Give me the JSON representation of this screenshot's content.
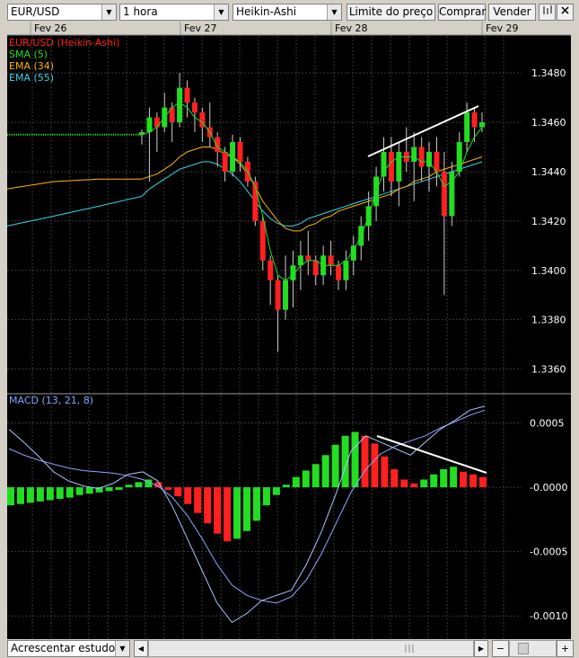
{
  "toolbar": {
    "symbol": "EUR/USD",
    "timeframe": "1 hora",
    "chart_style": "Heikin-Ashi",
    "limit_button": "Limite do preço",
    "buy_button": "Comprar",
    "sell_button": "Vender"
  },
  "date_labels": [
    "Fev 26",
    "Fev 27",
    "Fev 28",
    "Fev 29"
  ],
  "legend": [
    {
      "text": "EUR/USD (Heikin-Ashi)",
      "color": "#ff2020"
    },
    {
      "text": "SMA (5)",
      "color": "#22dd22"
    },
    {
      "text": "EMA (34)",
      "color": "#ffb400"
    },
    {
      "text": "EMA (55)",
      "color": "#33d6e8"
    }
  ],
  "price_ticks": [
    "1.3480",
    "1.3460",
    "1.3440",
    "1.3420",
    "1.3400",
    "1.3380",
    "1.3360"
  ],
  "macd": {
    "title": "MACD (13, 21, 8)",
    "ticks": [
      "0.0005",
      "-0.0000",
      "-0.0005",
      "-0.0010"
    ]
  },
  "bottom": {
    "add_study": "Acrescentar estudo"
  },
  "colors": {
    "background": "#000000",
    "grid": "#3a3a3a",
    "bull": "#22dd22",
    "bear": "#ff2020"
  },
  "chart_data": [
    {
      "type": "candlestick",
      "title": "EUR/USD (Heikin-Ashi)",
      "x_labels": [
        "Fev 26",
        "Fev 27",
        "Fev 28",
        "Fev 29"
      ],
      "ylim": [
        1.335,
        1.3495
      ],
      "candles": [
        [
          1.3455,
          1.3457,
          1.3451,
          1.3456
        ],
        [
          1.3456,
          1.3466,
          1.3436,
          1.3462
        ],
        [
          1.3462,
          1.3464,
          1.3448,
          1.3458
        ],
        [
          1.3458,
          1.3472,
          1.3456,
          1.3466
        ],
        [
          1.3466,
          1.3468,
          1.3452,
          1.346
        ],
        [
          1.346,
          1.348,
          1.3458,
          1.3474
        ],
        [
          1.3474,
          1.3477,
          1.3462,
          1.3468
        ],
        [
          1.3468,
          1.347,
          1.3456,
          1.3464
        ],
        [
          1.3464,
          1.3466,
          1.3452,
          1.3458
        ],
        [
          1.3458,
          1.3468,
          1.345,
          1.3454
        ],
        [
          1.3454,
          1.3456,
          1.3442,
          1.3448
        ],
        [
          1.3448,
          1.345,
          1.3436,
          1.344
        ],
        [
          1.344,
          1.3455,
          1.3438,
          1.3452
        ],
        [
          1.3452,
          1.3454,
          1.344,
          1.3444
        ],
        [
          1.3444,
          1.3446,
          1.3434,
          1.3436
        ],
        [
          1.3436,
          1.3438,
          1.3418,
          1.342
        ],
        [
          1.342,
          1.3422,
          1.34,
          1.3404
        ],
        [
          1.3404,
          1.3406,
          1.3386,
          1.3396
        ],
        [
          1.3396,
          1.3398,
          1.3367,
          1.3384
        ],
        [
          1.3384,
          1.3406,
          1.338,
          1.3396
        ],
        [
          1.3396,
          1.3408,
          1.3385,
          1.3402
        ],
        [
          1.3402,
          1.3412,
          1.3392,
          1.3406
        ],
        [
          1.3406,
          1.3416,
          1.3398,
          1.3404
        ],
        [
          1.3404,
          1.3406,
          1.3394,
          1.3398
        ],
        [
          1.3398,
          1.341,
          1.3394,
          1.3406
        ],
        [
          1.3406,
          1.3412,
          1.3398,
          1.3402
        ],
        [
          1.3402,
          1.3404,
          1.3392,
          1.3396
        ],
        [
          1.3396,
          1.3408,
          1.3392,
          1.3404
        ],
        [
          1.3404,
          1.3414,
          1.3398,
          1.341
        ],
        [
          1.341,
          1.3422,
          1.3404,
          1.3418
        ],
        [
          1.3418,
          1.3432,
          1.3412,
          1.3426
        ],
        [
          1.3426,
          1.3442,
          1.342,
          1.3438
        ],
        [
          1.3438,
          1.3454,
          1.3432,
          1.3448
        ],
        [
          1.3448,
          1.3454,
          1.343,
          1.3436
        ],
        [
          1.3436,
          1.3452,
          1.3426,
          1.3448
        ],
        [
          1.3448,
          1.3458,
          1.344,
          1.3444
        ],
        [
          1.3444,
          1.3456,
          1.3428,
          1.345
        ],
        [
          1.345,
          1.3454,
          1.3436,
          1.3442
        ],
        [
          1.3442,
          1.3452,
          1.3432,
          1.3448
        ],
        [
          1.3448,
          1.3454,
          1.3434,
          1.344
        ],
        [
          1.344,
          1.3448,
          1.339,
          1.3422
        ],
        [
          1.3422,
          1.3444,
          1.3418,
          1.344
        ],
        [
          1.344,
          1.3456,
          1.3438,
          1.3452
        ],
        [
          1.3452,
          1.3468,
          1.3448,
          1.3464
        ],
        [
          1.3464,
          1.3466,
          1.3452,
          1.3458
        ],
        [
          1.3458,
          1.3464,
          1.3456,
          1.346
        ]
      ],
      "sma5": [
        1.3455,
        1.3456,
        1.3458,
        1.3462,
        1.3466,
        1.3468,
        1.3466,
        1.3462,
        1.346,
        1.3456,
        1.345,
        1.3448,
        1.3446,
        1.3444,
        1.344,
        1.3434,
        1.3422,
        1.3408,
        1.3398,
        1.3396,
        1.3398,
        1.3402,
        1.3404,
        1.3404,
        1.3402,
        1.3402,
        1.3402,
        1.3404,
        1.3408,
        1.3414,
        1.3422,
        1.3432,
        1.344,
        1.3444,
        1.3446,
        1.3446,
        1.3446,
        1.3444,
        1.3444,
        1.344,
        1.3434,
        1.3436,
        1.344,
        1.3448,
        1.3454,
        1.3458
      ],
      "ema34": [
        1.3437,
        1.3438,
        1.3439,
        1.3441,
        1.3443,
        1.3446,
        1.3448,
        1.3449,
        1.345,
        1.345,
        1.3449,
        1.3447,
        1.3446,
        1.3443,
        1.3439,
        1.3434,
        1.3428,
        1.3424,
        1.342,
        1.3417,
        1.3416,
        1.3416,
        1.3418,
        1.3419,
        1.3421,
        1.3422,
        1.3424,
        1.3425,
        1.3426,
        1.3427,
        1.3428,
        1.3429,
        1.343,
        1.3431,
        1.3433,
        1.3434,
        1.3436,
        1.3437,
        1.3438,
        1.344,
        1.3441,
        1.3442,
        1.3443,
        1.3444,
        1.3445,
        1.3446
      ],
      "ema55": [
        1.343,
        1.3433,
        1.3435,
        1.3437,
        1.3439,
        1.3441,
        1.3442,
        1.3443,
        1.3444,
        1.3444,
        1.3443,
        1.3441,
        1.3439,
        1.3436,
        1.3432,
        1.3428,
        1.3424,
        1.3421,
        1.3419,
        1.3418,
        1.3418,
        1.3419,
        1.3421,
        1.3422,
        1.3423,
        1.3424,
        1.3425,
        1.3426,
        1.3427,
        1.3428,
        1.3429,
        1.343,
        1.3431,
        1.3432,
        1.3433,
        1.3434,
        1.3435,
        1.3436,
        1.3437,
        1.3438,
        1.3439,
        1.344,
        1.3441,
        1.3442,
        1.3443,
        1.3444
      ]
    },
    {
      "type": "bar",
      "title": "MACD (13, 21, 8)",
      "ylim": [
        -0.00118,
        0.00072
      ],
      "histogram": [
        -0.00014,
        -0.00013,
        -0.00012,
        -0.00011,
        -0.0001,
        -9e-05,
        -8e-05,
        -6e-05,
        -5e-05,
        -4e-05,
        -3e-05,
        -2e-05,
        2e-05,
        4e-05,
        6e-05,
        4e-05,
        -2e-05,
        -7e-05,
        -0.00013,
        -0.0002,
        -0.00028,
        -0.00036,
        -0.00042,
        -0.0004,
        -0.00034,
        -0.00026,
        -0.00014,
        -6e-05,
        2e-05,
        8e-05,
        0.00013,
        0.00018,
        0.00025,
        0.00033,
        0.0004,
        0.00043,
        0.0004,
        0.00034,
        0.00024,
        0.00014,
        6e-05,
        3e-05,
        6e-05,
        0.0001,
        0.00014,
        0.00016,
        0.00012,
        0.0001,
        8e-05
      ],
      "macd_line": [
        0.00045,
        0.00035,
        0.00024,
        0.00012,
        5e-05,
        1e-05,
        -1e-05,
        3e-05,
        0.0001,
        0.00012,
        5e-05,
        -0.00015,
        -0.0004,
        -0.00065,
        -0.0009,
        -0.00105,
        -0.00098,
        -0.00088,
        -0.00084,
        -0.0008,
        -0.0006,
        -0.00035,
        -5e-05,
        0.00028,
        0.0004,
        0.00035,
        0.0003,
        0.00025,
        0.00035,
        0.00045,
        0.00052,
        0.0006,
        0.00063
      ],
      "signal_line": [
        0.0003,
        0.00025,
        0.00021,
        0.00018,
        0.00015,
        0.00013,
        0.00012,
        0.00011,
        9e-05,
        6e-05,
        1e-05,
        -8e-05,
        -0.00022,
        -0.0004,
        -0.0006,
        -0.00076,
        -0.00084,
        -0.00088,
        -0.0009,
        -0.00085,
        -0.00072,
        -0.00052,
        -0.00028,
        -4e-05,
        0.00014,
        0.00026,
        0.00032,
        0.00036,
        0.0004,
        0.00046,
        0.00051,
        0.00056,
        0.0006
      ]
    }
  ]
}
